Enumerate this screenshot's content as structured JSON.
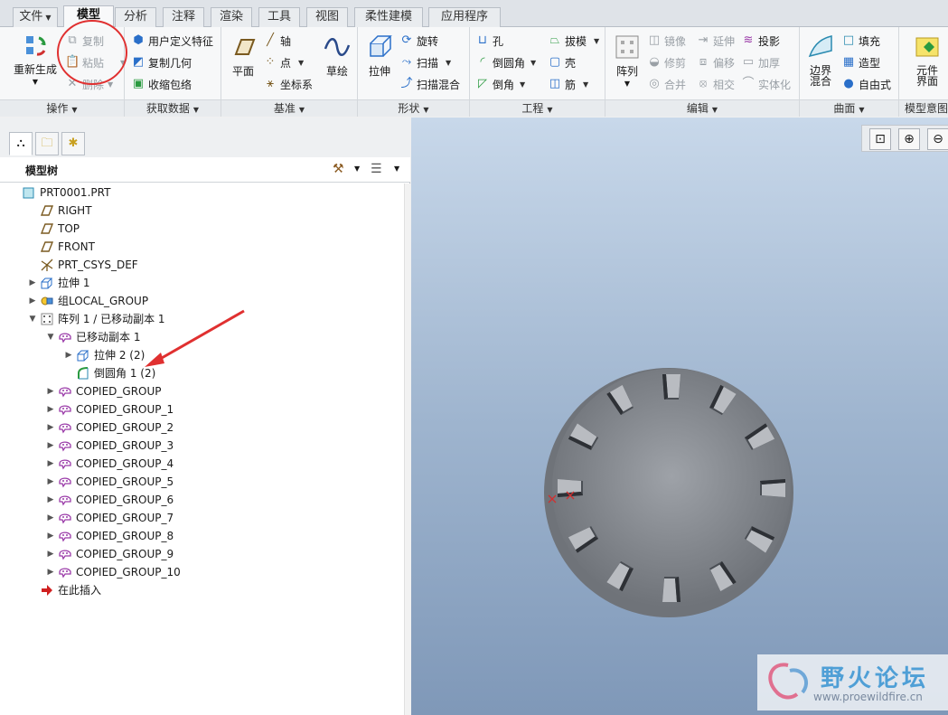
{
  "tabs": [
    {
      "label": "文件",
      "dropdown": true
    },
    {
      "label": "模型",
      "active": true
    },
    {
      "label": "分析"
    },
    {
      "label": "注释"
    },
    {
      "label": "渲染"
    },
    {
      "label": "工具"
    },
    {
      "label": "视图"
    },
    {
      "label": "柔性建模"
    },
    {
      "label": "应用程序"
    }
  ],
  "ribbon": {
    "operations": {
      "label": "操作",
      "regenerate": "重新生成",
      "copy": "复制",
      "paste": "粘贴",
      "delete": "删除"
    },
    "get_data": {
      "label": "获取数据",
      "udf": "用户定义特征",
      "copy_geom": "复制几何",
      "shrinkwrap": "收缩包络"
    },
    "datum": {
      "label": "基准",
      "plane": "平面",
      "axis": "轴",
      "point": "点",
      "csys": "坐标系",
      "sketch": "草绘"
    },
    "shapes": {
      "label": "形状",
      "extrude": "拉伸",
      "revolve": "旋转",
      "sweep": "扫描",
      "swept_blend": "扫描混合"
    },
    "engineering": {
      "label": "工程",
      "hole": "孔",
      "round": "倒圆角",
      "chamfer": "倒角",
      "draft": "拔模",
      "shell": "壳",
      "rib": "筋"
    },
    "editing": {
      "label": "编辑",
      "pattern": "阵列",
      "mirror": "镜像",
      "trim": "修剪",
      "merge": "合并",
      "extend": "延伸",
      "offset": "偏移",
      "intersect": "相交",
      "project": "投影",
      "thicken": "加厚",
      "solidify": "实体化"
    },
    "surfaces": {
      "label": "曲面",
      "boundary_blend": "边界混合",
      "fill": "填充",
      "style": "造型",
      "freestyle": "自由式"
    },
    "model_intent": {
      "label": "模型意图",
      "component_interface": "元件界面"
    }
  },
  "model_tree": {
    "title": "模型树",
    "items": [
      {
        "label": "PRT0001.PRT",
        "icon": "part-icon",
        "level": 0,
        "twisty": ""
      },
      {
        "label": "RIGHT",
        "icon": "datum-plane-icon",
        "level": 1,
        "twisty": ""
      },
      {
        "label": "TOP",
        "icon": "datum-plane-icon",
        "level": 1,
        "twisty": ""
      },
      {
        "label": "FRONT",
        "icon": "datum-plane-icon",
        "level": 1,
        "twisty": ""
      },
      {
        "label": "PRT_CSYS_DEF",
        "icon": "csys-icon",
        "level": 1,
        "twisty": ""
      },
      {
        "label": "拉伸 1",
        "icon": "extrude-icon",
        "level": 1,
        "twisty": "collapsed"
      },
      {
        "label": "组LOCAL_GROUP",
        "icon": "group-icon",
        "level": 1,
        "twisty": "collapsed"
      },
      {
        "label": "阵列 1 / 已移动副本 1",
        "icon": "pattern-icon",
        "level": 1,
        "twisty": "expanded"
      },
      {
        "label": "已移动副本 1",
        "icon": "copied-group-icon",
        "level": 2,
        "twisty": "expanded"
      },
      {
        "label": "拉伸 2 (2)",
        "icon": "extrude-icon",
        "level": 3,
        "twisty": "collapsed"
      },
      {
        "label": "倒圆角 1 (2)",
        "icon": "round-icon",
        "level": 3,
        "twisty": ""
      },
      {
        "label": "COPIED_GROUP",
        "icon": "copied-group-icon",
        "level": 2,
        "twisty": "collapsed"
      },
      {
        "label": "COPIED_GROUP_1",
        "icon": "copied-group-icon",
        "level": 2,
        "twisty": "collapsed"
      },
      {
        "label": "COPIED_GROUP_2",
        "icon": "copied-group-icon",
        "level": 2,
        "twisty": "collapsed"
      },
      {
        "label": "COPIED_GROUP_3",
        "icon": "copied-group-icon",
        "level": 2,
        "twisty": "collapsed"
      },
      {
        "label": "COPIED_GROUP_4",
        "icon": "copied-group-icon",
        "level": 2,
        "twisty": "collapsed"
      },
      {
        "label": "COPIED_GROUP_5",
        "icon": "copied-group-icon",
        "level": 2,
        "twisty": "collapsed"
      },
      {
        "label": "COPIED_GROUP_6",
        "icon": "copied-group-icon",
        "level": 2,
        "twisty": "collapsed"
      },
      {
        "label": "COPIED_GROUP_7",
        "icon": "copied-group-icon",
        "level": 2,
        "twisty": "collapsed"
      },
      {
        "label": "COPIED_GROUP_8",
        "icon": "copied-group-icon",
        "level": 2,
        "twisty": "collapsed"
      },
      {
        "label": "COPIED_GROUP_9",
        "icon": "copied-group-icon",
        "level": 2,
        "twisty": "collapsed"
      },
      {
        "label": "COPIED_GROUP_10",
        "icon": "copied-group-icon",
        "level": 2,
        "twisty": "collapsed"
      },
      {
        "label": "在此插入",
        "icon": "insert-here-icon",
        "level": 1,
        "twisty": ""
      }
    ]
  },
  "watermark": {
    "title": "野火论坛",
    "url": "www.proewildfire.cn"
  },
  "colors": {
    "accent_red": "#e03030",
    "viewport_top": "#c8d8ea",
    "viewport_bottom": "#7f98b8",
    "part_gray": "#8c9096"
  }
}
